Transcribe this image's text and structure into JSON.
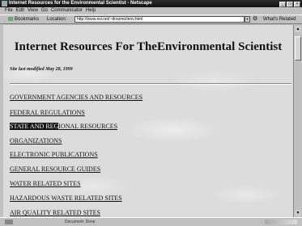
{
  "window": {
    "title": "Internet Resources for the Environmental Scientist - Netscape"
  },
  "menu": [
    "File",
    "Edit",
    "View",
    "Go",
    "Communicator",
    "Help"
  ],
  "location": {
    "bookmarks_label": "Bookmarks",
    "location_label": "Location:",
    "url": "http://www.esi.net/~drsomo/ienv.html",
    "related_label": "What's Related"
  },
  "page": {
    "title": "Internet Resources For TheEnvironmental Scientist",
    "modified": "Site last modified May 28, 1999",
    "links": [
      "GOVERNMENT AGENCIES AND RESOURCES",
      "FEDERAL REGULATIONS",
      "STATE AND REGIONAL RESOURCES",
      "ORGANIZATIONS",
      "ELECTRONIC PUBLICATIONS",
      "GENERAL RESOURCE GUIDES",
      "WATER RELATED SITES",
      "HAZARDOUS WASTE RELATED SITES",
      "AIR QUALITY RELATED SITES"
    ],
    "highlighted_part": "STATE AND REG",
    "highlighted_rest": "IONAL RESOURCES"
  },
  "status": {
    "text": "Document: Done"
  }
}
